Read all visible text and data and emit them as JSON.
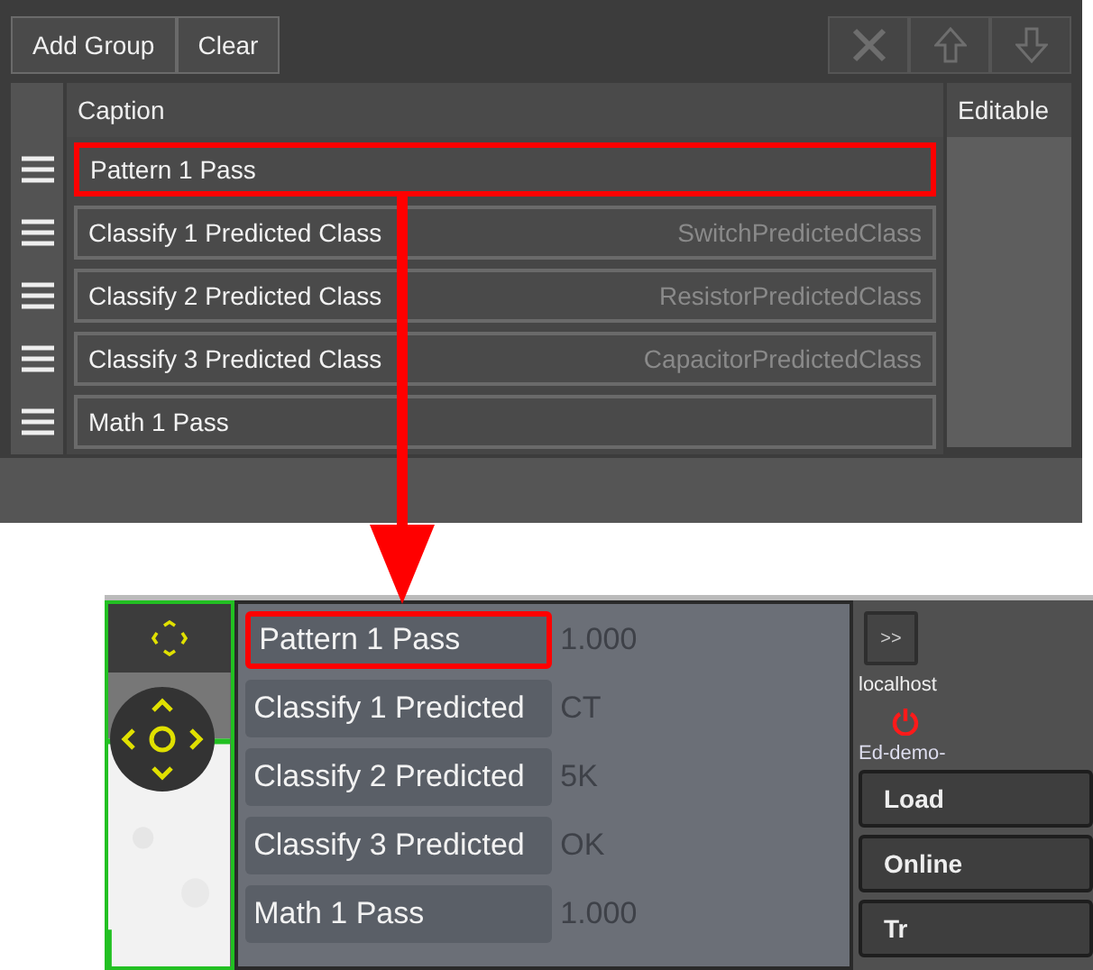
{
  "group_editor": {
    "buttons": [
      {
        "label": "Add Group"
      },
      {
        "label": "Clear"
      }
    ],
    "tool_buttons": [
      {
        "kind": "delete",
        "disabled": true
      },
      {
        "kind": "up",
        "disabled": true
      },
      {
        "kind": "down",
        "disabled": true
      }
    ],
    "columns": [
      "Caption",
      "Editable"
    ],
    "rows": [
      {
        "caption": "Pattern 1 Pass",
        "highlighted": true
      },
      {
        "caption": "Classify 1 Predicted Class",
        "placeholder": "SwitchPredictedClass",
        "highlighted": false
      },
      {
        "caption": "Classify 2 Predicted Class",
        "placeholder": "ResistorPredictedClass",
        "highlighted": false
      },
      {
        "caption": "Classify 3 Predicted Class",
        "placeholder": "CapacitorPredictedClass",
        "highlighted": false
      },
      {
        "caption": "Math 1 Pass",
        "highlighted": false
      }
    ]
  },
  "results_panel": {
    "rows": [
      {
        "label": "Pattern 1 Pass",
        "value": "1.000",
        "highlighted": true
      },
      {
        "label": "Classify 1 Predicted",
        "value": "CT",
        "highlighted": false
      },
      {
        "label": "Classify 2 Predicted",
        "value": "5K",
        "highlighted": false
      },
      {
        "label": "Classify 3 Predicted",
        "value": "OK",
        "highlighted": false
      },
      {
        "label": "Math 1 Pass",
        "value": "1.000",
        "highlighted": false
      }
    ]
  },
  "side_panel": {
    "expand_button": ">>",
    "host": "localhost",
    "job": "Ed-demo-",
    "buttons": [
      "Load",
      "Online",
      "Tr"
    ]
  }
}
